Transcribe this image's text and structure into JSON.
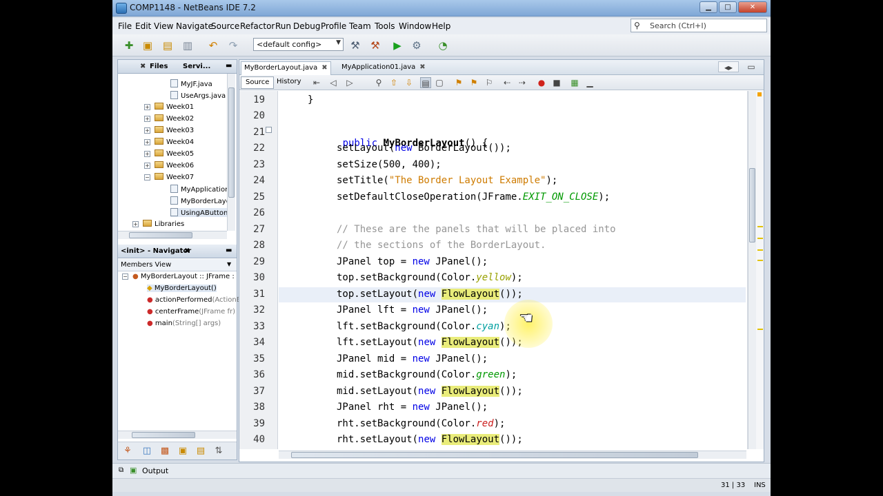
{
  "window": {
    "title": "COMP1148 - NetBeans IDE 7.2"
  },
  "menu": [
    "File",
    "Edit",
    "View",
    "Navigate",
    "Source",
    "Refactor",
    "Run",
    "Debug",
    "Profile",
    "Team",
    "Tools",
    "Window",
    "Help"
  ],
  "search": {
    "placeholder": "Search (Ctrl+I)"
  },
  "toolbar": {
    "config": "<default config>"
  },
  "project_panel": {
    "tabs": [
      "Files",
      "Servi..."
    ],
    "tree": [
      {
        "label": "MyJF.java",
        "type": "file"
      },
      {
        "label": "UseArgs.java",
        "type": "file"
      },
      {
        "label": "Week01",
        "type": "folder"
      },
      {
        "label": "Week02",
        "type": "folder"
      },
      {
        "label": "Week03",
        "type": "folder"
      },
      {
        "label": "Week04",
        "type": "folder"
      },
      {
        "label": "Week05",
        "type": "folder"
      },
      {
        "label": "Week06",
        "type": "folder"
      },
      {
        "label": "Week07",
        "type": "folder"
      },
      {
        "label": "MyApplication",
        "type": "file"
      },
      {
        "label": "MyBorderLayo",
        "type": "file"
      },
      {
        "label": "UsingAButton",
        "type": "file"
      },
      {
        "label": "Libraries",
        "type": "folder"
      }
    ]
  },
  "navigator": {
    "title": "<init> - Navigator",
    "view": "Members View",
    "items": [
      {
        "name": "MyBorderLayout :: JFrame :",
        "extra": ""
      },
      {
        "name": "MyBorderLayout()",
        "extra": ""
      },
      {
        "name": "actionPerformed",
        "extra": "(ActionE"
      },
      {
        "name": "centerFrame",
        "extra": "(JFrame fr)"
      },
      {
        "name": "main",
        "extra": "(String[] args)"
      }
    ]
  },
  "editor": {
    "tabs": [
      "MyBorderLayout.java",
      "MyApplication01.java"
    ],
    "modes": [
      "Source",
      "History"
    ],
    "lines": [
      {
        "n": "19"
      },
      {
        "n": "20"
      },
      {
        "n": "21"
      },
      {
        "n": "22"
      },
      {
        "n": "23"
      },
      {
        "n": "24"
      },
      {
        "n": "25"
      },
      {
        "n": "26"
      },
      {
        "n": "27"
      },
      {
        "n": "28"
      },
      {
        "n": "29"
      },
      {
        "n": "30"
      },
      {
        "n": "31"
      },
      {
        "n": "32"
      },
      {
        "n": "33"
      },
      {
        "n": "34"
      },
      {
        "n": "35"
      },
      {
        "n": "36"
      },
      {
        "n": "37"
      },
      {
        "n": "38"
      },
      {
        "n": "39"
      },
      {
        "n": "40"
      }
    ],
    "code": {
      "l19": "}",
      "l21_kw": "public",
      "l21_name": "MyBorderLayout",
      "l21_rest": "() {",
      "l22_a": "setLayout(",
      "l22_kw": "new",
      "l22_b": " BorderLayout());",
      "l23": "setSize(500, 400);",
      "l24_a": "setTitle(",
      "l24_str": "\"The Border Layout Example\"",
      "l24_b": ");",
      "l25_a": "setDefaultCloseOperation(JFrame.",
      "l25_fld": "EXIT_ON_CLOSE",
      "l25_b": ");",
      "l27": "// These are the panels that will be placed into",
      "l28": "// the sections of the BorderLayout.",
      "l29_a": "JPanel top = ",
      "l29_kw": "new",
      "l29_b": " JPanel();",
      "l30_a": "top.setBackground(Color.",
      "l30_fld": "yellow",
      "l30_b": ");",
      "l31_a": "top.setLayout(",
      "l31_kw": "new",
      "l31_hl": "FlowLayout",
      "l31_b": "());",
      "l32_a": "JPanel lft = ",
      "l32_kw": "new",
      "l32_b": " JPanel();",
      "l33_a": "lft.setBackground(Color.",
      "l33_fld": "cyan",
      "l33_b": ");",
      "l34_a": "lft.setLayout(",
      "l34_kw": "new",
      "l34_hl": "FlowLayout",
      "l34_b": "());",
      "l35_a": "JPanel mid = ",
      "l35_kw": "new",
      "l35_b": " JPanel();",
      "l36_a": "mid.setBackground(Color.",
      "l36_fld": "green",
      "l36_b": ");",
      "l37_a": "mid.setLayout(",
      "l37_kw": "new",
      "l37_hl": "FlowLayout",
      "l37_b": "());",
      "l38_a": "JPanel rht = ",
      "l38_kw": "new",
      "l38_b": " JPanel();",
      "l39_a": "rht.setBackground(Color.",
      "l39_fld": "red",
      "l39_b": ");",
      "l40_a": "rht.setLayout(",
      "l40_kw": "new",
      "l40_hl": "FlowLayout",
      "l40_b": "());"
    }
  },
  "output_tab": "Output",
  "status": {
    "position": "31 | 33",
    "mode": "INS"
  },
  "colors": {
    "keyword": "#0000e6",
    "string": "#ce7b00",
    "field": "#009900",
    "comment": "#969696",
    "highlight": "#e9ec7a"
  }
}
